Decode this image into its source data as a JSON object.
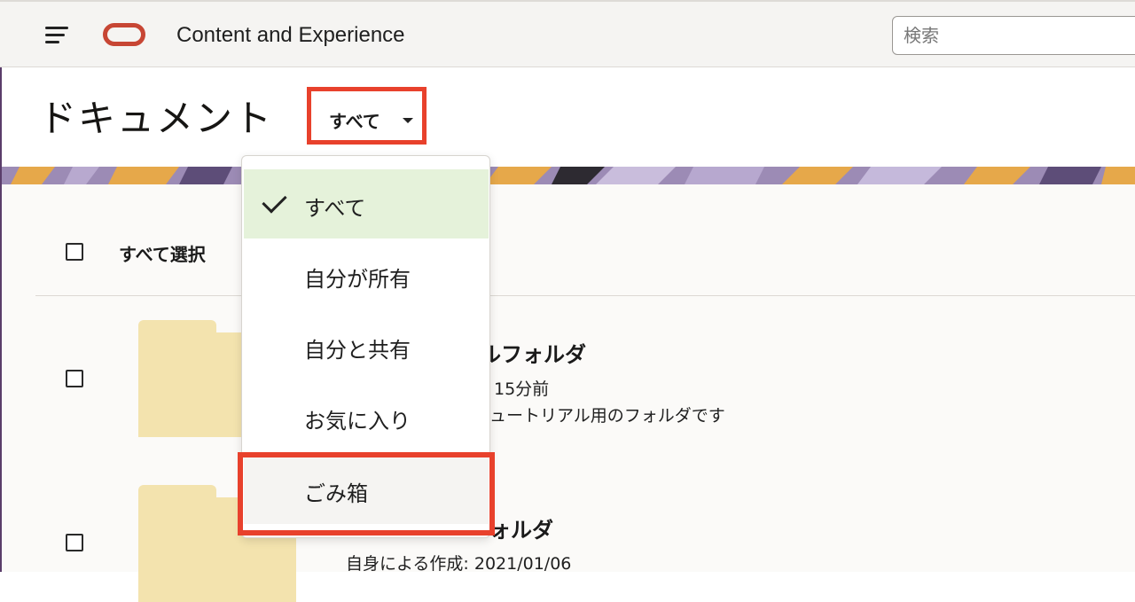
{
  "header": {
    "app_title": "Content and Experience",
    "search_placeholder": "検索"
  },
  "page": {
    "title": "ドキュメント",
    "filter_selected": "すべて"
  },
  "list": {
    "select_all_label": "すべて選択",
    "items": [
      {
        "name_visible": "ルフォルダ",
        "meta_line1": "15分前",
        "meta_line2": "ュートリアル用のフォルダです"
      },
      {
        "name_visible": "ォルダ",
        "meta_line1": "自身による作成: 2021/01/06"
      }
    ]
  },
  "filter_menu": {
    "items": [
      {
        "label": "すべて",
        "selected": true
      },
      {
        "label": "自分が所有",
        "selected": false
      },
      {
        "label": "自分と共有",
        "selected": false
      },
      {
        "label": "お気に入り",
        "selected": false
      },
      {
        "label": "ごみ箱",
        "selected": false
      }
    ]
  },
  "colors": {
    "brand": "#c74634",
    "annotation": "#e8412c",
    "selected_bg": "#e5f2da",
    "folder": "#f3e3ae"
  }
}
